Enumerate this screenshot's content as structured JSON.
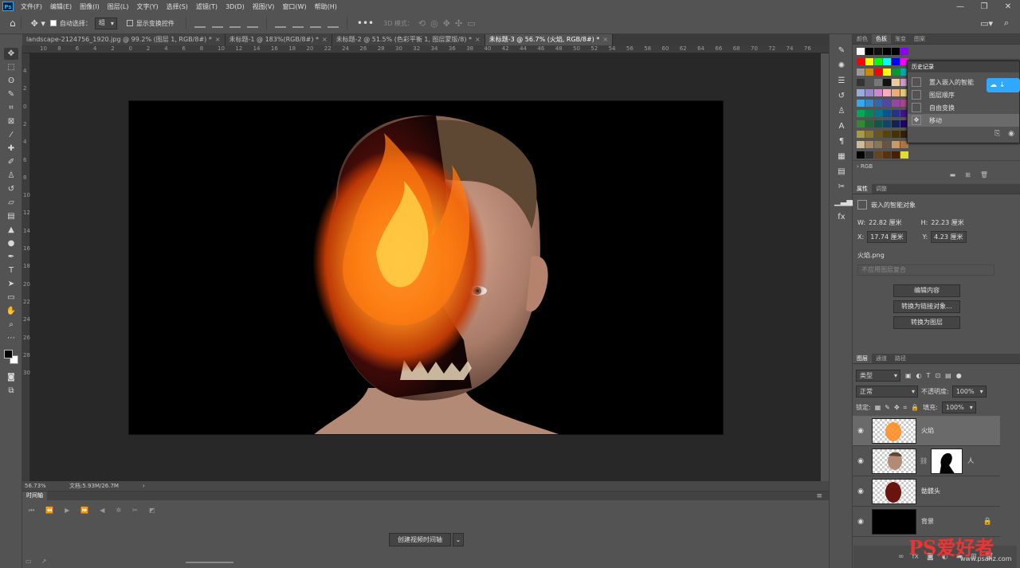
{
  "menu": {
    "logo": "Ps",
    "items": [
      "文件(F)",
      "编辑(E)",
      "图像(I)",
      "图层(L)",
      "文字(Y)",
      "选择(S)",
      "滤镜(T)",
      "3D(D)",
      "视图(V)",
      "窗口(W)",
      "帮助(H)"
    ],
    "window_controls": [
      "—",
      "❐",
      "✕"
    ]
  },
  "options": {
    "auto_select_label": "自动选择：",
    "auto_select_value": "组",
    "show_transform_label": "显示变换控件",
    "mode_3d_label": "3D 模式："
  },
  "tabs": [
    {
      "label": "landscape-2124756_1920.jpg @ 99.2% (图层 1, RGB/8#) *"
    },
    {
      "label": "未标题-1 @ 183%(RGB/8#) *"
    },
    {
      "label": "未标题-2 @ 51.5% (色彩平衡 1, 图层蒙版/8) *"
    },
    {
      "label": "未标题-3 @ 56.7% (火焰, RGB/8#) *"
    }
  ],
  "ruler_h": [
    "10",
    "8",
    "6",
    "4",
    "2",
    "0",
    "2",
    "4",
    "6",
    "8",
    "10",
    "12",
    "14",
    "16",
    "18",
    "20",
    "22",
    "24",
    "26",
    "28",
    "30",
    "32",
    "34",
    "36",
    "38",
    "40",
    "42",
    "44",
    "46",
    "48",
    "50",
    "52",
    "54",
    "56",
    "58",
    "60",
    "62",
    "64",
    "66",
    "68",
    "70",
    "72",
    "74",
    "76"
  ],
  "ruler_v": [
    "4",
    "2",
    "0",
    "2",
    "4",
    "6",
    "8",
    "10",
    "12",
    "14",
    "16",
    "18",
    "20",
    "22",
    "24",
    "26",
    "28",
    "30"
  ],
  "status": {
    "zoom": "56.73%",
    "doc": "文档:5.93M/26.7M"
  },
  "timeline": {
    "tab": "时间轴",
    "create_btn": "创建视频时间轴"
  },
  "color_panel": {
    "tabs": [
      "颜色",
      "色板",
      "渐变",
      "图案"
    ],
    "active_tab": "色板",
    "group_label": "RGB"
  },
  "history": {
    "title": "历史记录",
    "items": [
      "置入嵌入的智能",
      "图层顺序",
      "自由变换",
      "移动"
    ]
  },
  "properties": {
    "tabs": [
      "属性",
      "调整"
    ],
    "type_label": "嵌入的智能对象",
    "w_label": "W:",
    "w_value": "22.82 厘米",
    "h_label": "H:",
    "h_value": "22.23 厘米",
    "x_label": "X:",
    "x_value": "17.74 厘米",
    "y_label": "Y:",
    "y_value": "4.23 厘米",
    "file_name": "火焰.png",
    "comp_placeholder": "不应用图层复合",
    "buttons": [
      "编辑内容",
      "转换为链接对象...",
      "转换为图层"
    ]
  },
  "layers": {
    "tabs": [
      "图层",
      "通道",
      "路径"
    ],
    "filter": "类型",
    "blend_mode": "正常",
    "opacity_label": "不透明度:",
    "opacity": "100%",
    "lock_label": "锁定:",
    "fill_label": "填充:",
    "fill": "100%",
    "items": [
      {
        "name": "火焰"
      },
      {
        "name": "人"
      },
      {
        "name": "骷髅头"
      },
      {
        "name": "背景"
      }
    ]
  },
  "watermark": {
    "logo": "PS爱好者",
    "url": "www.psahz.com"
  },
  "colors": {
    "accent": "#31a8ff",
    "canvas_bg": "#000000",
    "panel": "#535353"
  }
}
